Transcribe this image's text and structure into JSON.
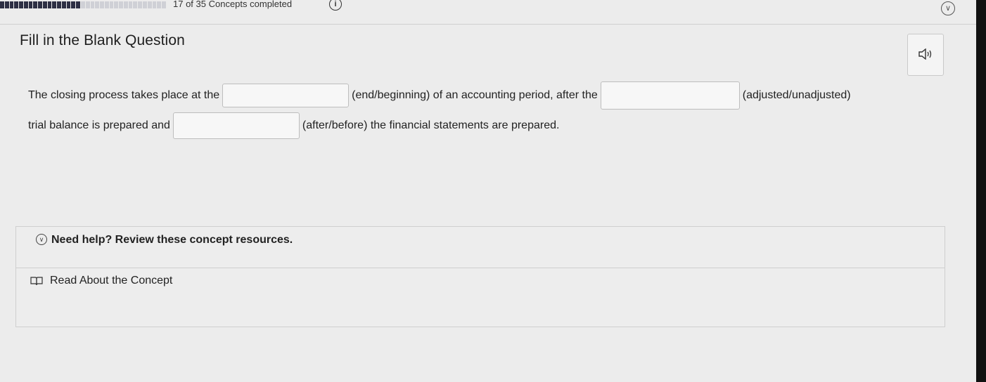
{
  "progress": {
    "completed": 17,
    "total": 35,
    "text": "17 of 35 Concepts completed"
  },
  "question": {
    "type_label": "Fill in the Blank Question",
    "line1": {
      "part1": "The closing process takes place at the",
      "part2": "(end/beginning) of an accounting period, after the",
      "part3": "(adjusted/unadjusted)"
    },
    "line2": {
      "part1": "trial balance is prepared and",
      "part2": "(after/before) the financial statements are prepared."
    },
    "blanks": [
      "",
      "",
      ""
    ]
  },
  "help": {
    "title": "Need help? Review these concept resources.",
    "resource_label": "Read About the Concept"
  },
  "icons": {
    "info": "info-icon",
    "collapse": "chevron-down-circle-icon",
    "audio": "speaker-icon",
    "book": "book-icon"
  },
  "colors": {
    "progress_done": "#2d2f44",
    "progress_todo": "#cfd0d6",
    "background": "#ececec"
  }
}
